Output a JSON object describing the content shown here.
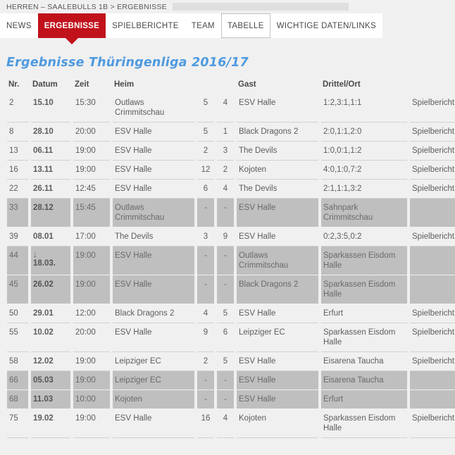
{
  "breadcrumb": {
    "text": "HERREN – SAALEBULLS 1B > ERGEBNISSE"
  },
  "nav": {
    "items": [
      {
        "label": "NEWS",
        "state": "normal"
      },
      {
        "label": "ERGEBNISSE",
        "state": "active"
      },
      {
        "label": "SPIELBERICHTE",
        "state": "normal"
      },
      {
        "label": "TEAM",
        "state": "normal"
      },
      {
        "label": "TABELLE",
        "state": "focused"
      },
      {
        "label": "WICHTIGE DATEN/LINKS",
        "state": "normal"
      }
    ]
  },
  "page": {
    "title": "Ergebnisse Thüringenliga 2016/17",
    "title_color": "#4f9ae0",
    "accent_color": "#c1121c"
  },
  "table": {
    "headers": {
      "nr": "Nr.",
      "date": "Datum",
      "time": "Zeit",
      "home": "Heim",
      "score_home": "",
      "score_away": "",
      "away": "Gast",
      "location": "Drittel/Ort",
      "report": ""
    },
    "rows": [
      {
        "nr": "2",
        "date": "15.10",
        "date_arrow": "",
        "time": "15:30",
        "home": "Outlaws Crimmitschau",
        "sa": "5",
        "sb": "4",
        "away": "ESV Halle",
        "loc": "1:2,3:1,1:1",
        "report": "Spielbericht",
        "shaded": false
      },
      {
        "nr": "8",
        "date": "28.10",
        "date_arrow": "",
        "time": "20:00",
        "home": "ESV Halle",
        "sa": "5",
        "sb": "1",
        "away": "Black Dragons 2",
        "loc": "2:0,1:1,2:0",
        "report": "Spielbericht",
        "shaded": false
      },
      {
        "nr": "13",
        "date": "06.11",
        "date_arrow": "",
        "time": "19:00",
        "home": "ESV Halle",
        "sa": "2",
        "sb": "3",
        "away": "The Devils",
        "loc": "1:0,0:1,1:2",
        "report": "Spielbericht",
        "shaded": false
      },
      {
        "nr": "16",
        "date": "13.11",
        "date_arrow": "",
        "time": "19:00",
        "home": "ESV Halle",
        "sa": "12",
        "sb": "2",
        "away": "Kojoten",
        "loc": "4:0,1:0,7:2",
        "report": "Spielbericht",
        "shaded": false
      },
      {
        "nr": "22",
        "date": "26.11",
        "date_arrow": "",
        "time": "12:45",
        "home": "ESV Halle",
        "sa": "6",
        "sb": "4",
        "away": "The Devils",
        "loc": "2:1,1:1,3:2",
        "report": "Spielbericht",
        "shaded": false
      },
      {
        "nr": "33",
        "date": "28.12",
        "date_arrow": "",
        "time": "15:45",
        "home": "Outlaws Crimmitschau",
        "sa": "-",
        "sb": "-",
        "away": "ESV Halle",
        "loc": "Sahnpark Crimmitschau",
        "report": "",
        "shaded": true
      },
      {
        "nr": "39",
        "date": "08.01",
        "date_arrow": "",
        "time": "17:00",
        "home": "The Devils",
        "sa": "3",
        "sb": "9",
        "away": "ESV Halle",
        "loc": "0:2,3:5,0:2",
        "report": "Spielbericht",
        "shaded": false
      },
      {
        "nr": "44",
        "date": "18.03.",
        "date_arrow": "↓",
        "time": "19:00",
        "home": "ESV Halle",
        "sa": "-",
        "sb": "-",
        "away": "Outlaws Crimmitschau",
        "loc": "Sparkassen Eisdom Halle",
        "report": "",
        "shaded": true
      },
      {
        "nr": "45",
        "date": "26.02",
        "date_arrow": "",
        "time": "19:00",
        "home": "ESV Halle",
        "sa": "-",
        "sb": "-",
        "away": "Black Dragons 2",
        "loc": "Sparkassen Eisdom Halle",
        "report": "",
        "shaded": true
      },
      {
        "nr": "50",
        "date": "29.01",
        "date_arrow": "",
        "time": "12:00",
        "home": "Black Dragons 2",
        "sa": "4",
        "sb": "5",
        "away": "ESV Halle",
        "loc": "Erfurt",
        "report": "Spielbericht",
        "shaded": false
      },
      {
        "nr": "55",
        "date": "10.02",
        "date_arrow": "",
        "time": "20:00",
        "home": "ESV Halle",
        "sa": "9",
        "sb": "6",
        "away": "Leipziger EC",
        "loc": "Sparkassen Eisdom Halle",
        "report": "Spielbericht",
        "shaded": false
      },
      {
        "nr": "58",
        "date": "12.02",
        "date_arrow": "",
        "time": "19:00",
        "home": "Leipziger EC",
        "sa": "2",
        "sb": "5",
        "away": "ESV Halle",
        "loc": "Eisarena Taucha",
        "report": "Spielbericht",
        "shaded": false
      },
      {
        "nr": "66",
        "date": "05.03",
        "date_arrow": "",
        "time": "19:00",
        "home": "Leipziger EC",
        "sa": "-",
        "sb": "-",
        "away": "ESV Halle",
        "loc": "Eisarena Taucha",
        "report": "",
        "shaded": true
      },
      {
        "nr": "68",
        "date": "11.03",
        "date_arrow": "",
        "time": "10:00",
        "home": "Kojoten",
        "sa": "-",
        "sb": "-",
        "away": "ESV Halle",
        "loc": "Erfurt",
        "report": "",
        "shaded": true
      },
      {
        "nr": "75",
        "date": "19.02",
        "date_arrow": "",
        "time": "19:00",
        "home": "ESV Halle",
        "sa": "16",
        "sb": "4",
        "away": "Kojoten",
        "loc": "Sparkassen Eisdom Halle",
        "report": "Spielbericht",
        "shaded": false
      }
    ]
  }
}
